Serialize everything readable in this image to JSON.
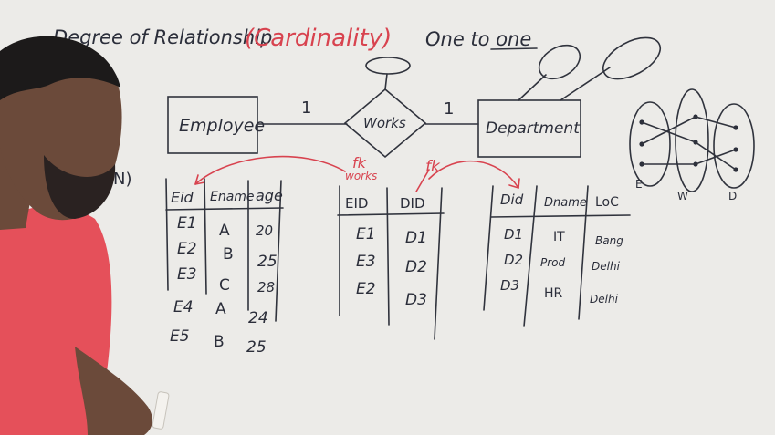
{
  "heading": {
    "prefix": "Degree of Relationship",
    "paren_word": "(Cardinality)",
    "type": "One to one"
  },
  "er": {
    "entity_left": "Employee",
    "relationship": "Works",
    "entity_right": "Department",
    "card_left": "1",
    "card_right": "1"
  },
  "fk_labels": {
    "left": "fk",
    "works": "works",
    "right": "fk"
  },
  "side_note": "N)",
  "employee_table": {
    "headers": [
      "Eid",
      "Ename",
      "age"
    ],
    "rows": [
      [
        "E1",
        "A",
        "20"
      ],
      [
        "E2",
        "B",
        "25"
      ],
      [
        "E3",
        "C",
        "28"
      ],
      [
        "E4",
        "A",
        "24"
      ],
      [
        "E5",
        "B",
        "25"
      ]
    ]
  },
  "works_table": {
    "headers": [
      "EID",
      "DID"
    ],
    "rows": [
      [
        "E1",
        "D1"
      ],
      [
        "E3",
        "D2"
      ],
      [
        "E2",
        "D3"
      ]
    ]
  },
  "department_table": {
    "headers": [
      "Did",
      "Dname",
      "LoC"
    ],
    "rows": [
      [
        "D1",
        "IT",
        "Bang"
      ],
      [
        "D2",
        "Prod",
        "Delhi"
      ],
      [
        "D3",
        "HR",
        "Delhi"
      ]
    ]
  },
  "mapping_labels": [
    "E",
    "W",
    "D"
  ],
  "colors": {
    "board": "#ecebe8",
    "ink": "#2b2e3a",
    "red_ink": "#d8434f",
    "shirt": "#e5505a",
    "skin": "#6b4a3a",
    "hair": "#1c1a1a"
  }
}
